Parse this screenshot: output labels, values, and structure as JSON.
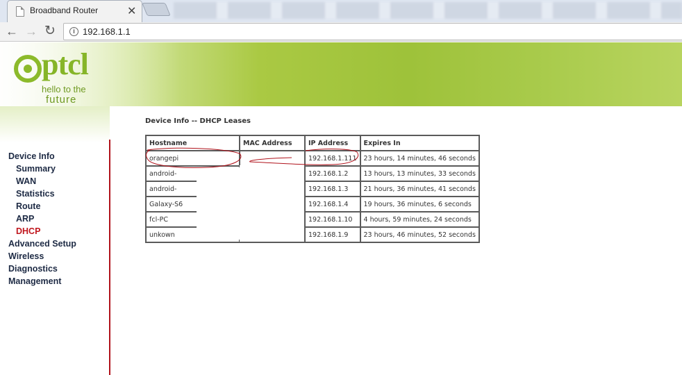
{
  "browser": {
    "tab_title": "Broadband Router",
    "url": "192.168.1.1"
  },
  "logo": {
    "word": "ptcl",
    "tagline1": "hello to the",
    "tagline2": "future"
  },
  "sidebar": {
    "items": [
      {
        "label": "Device Info",
        "level": 0
      },
      {
        "label": "Summary",
        "level": 1
      },
      {
        "label": "WAN",
        "level": 1
      },
      {
        "label": "Statistics",
        "level": 1
      },
      {
        "label": "Route",
        "level": 1
      },
      {
        "label": "ARP",
        "level": 1
      },
      {
        "label": "DHCP",
        "level": 1,
        "active": true
      },
      {
        "label": "Advanced Setup",
        "level": 0
      },
      {
        "label": "Wireless",
        "level": 0
      },
      {
        "label": "Diagnostics",
        "level": 0
      },
      {
        "label": "Management",
        "level": 0
      }
    ]
  },
  "main": {
    "title": "Device Info -- DHCP Leases",
    "table": {
      "headers": [
        "Hostname",
        "MAC Address",
        "IP Address",
        "Expires In"
      ],
      "rows": [
        [
          "orangepi",
          "",
          "192.168.1.111",
          "23 hours, 14 minutes, 46 seconds"
        ],
        [
          "android-",
          "",
          "192.168.1.2",
          "13 hours, 13 minutes, 33 seconds"
        ],
        [
          "android-",
          "",
          "192.168.1.3",
          "21 hours, 36 minutes, 41 seconds"
        ],
        [
          "Galaxy-S6",
          "",
          "192.168.1.4",
          "19 hours, 36 minutes, 6 seconds"
        ],
        [
          "fcl-PC",
          "",
          "192.168.1.10",
          "4 hours, 59 minutes, 24 seconds"
        ],
        [
          "unkown",
          "",
          "192.168.1.9",
          "23 hours, 46 minutes, 52 seconds"
        ]
      ]
    }
  },
  "colors": {
    "brand_green": "#8cba2b",
    "active_nav": "#c0171e",
    "annotation_red": "#b0121b"
  }
}
